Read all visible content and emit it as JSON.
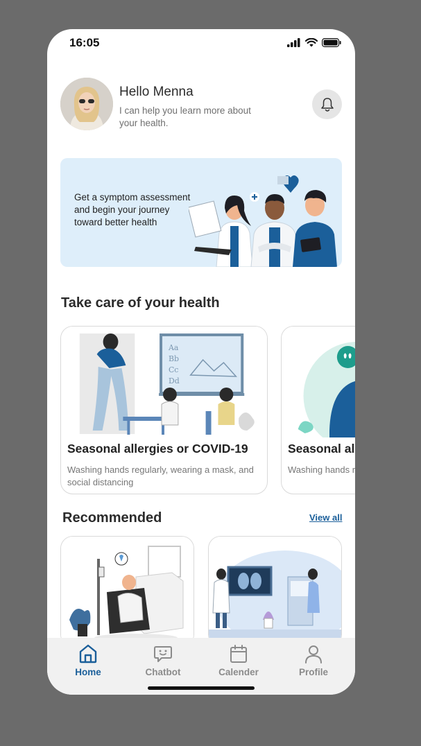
{
  "status_bar": {
    "time": "16:05",
    "icons": [
      "signal-icon",
      "wifi-icon",
      "battery-icon"
    ]
  },
  "header": {
    "greeting": "Hello Menna",
    "subtext": "I can help you learn  more about your health.",
    "notification_icon": "bell-icon"
  },
  "banner": {
    "text": "Get a symptom assessment and begin your journey toward better health"
  },
  "health_section": {
    "title": "Take care of your health",
    "cards": [
      {
        "title": "Seasonal allergies or COVID-19",
        "description": "Washing hands regularly, wearing a mask, and social distancing"
      },
      {
        "title": "Seasonal all",
        "description": "Washing hands r social distancing"
      }
    ]
  },
  "recommended": {
    "title": "Recommended",
    "view_all": "View all"
  },
  "bottom_nav": {
    "items": [
      {
        "label": "Home",
        "icon": "home-icon",
        "active": true
      },
      {
        "label": "Chatbot",
        "icon": "chat-icon",
        "active": false
      },
      {
        "label": "Calender",
        "icon": "calendar-icon",
        "active": false
      },
      {
        "label": "Profile",
        "icon": "profile-icon",
        "active": false
      }
    ]
  },
  "colors": {
    "accent": "#1b5f9a",
    "banner_bg": "#deeefa",
    "nav_bg": "#f1f1f1",
    "background": "#6b6b6b"
  }
}
